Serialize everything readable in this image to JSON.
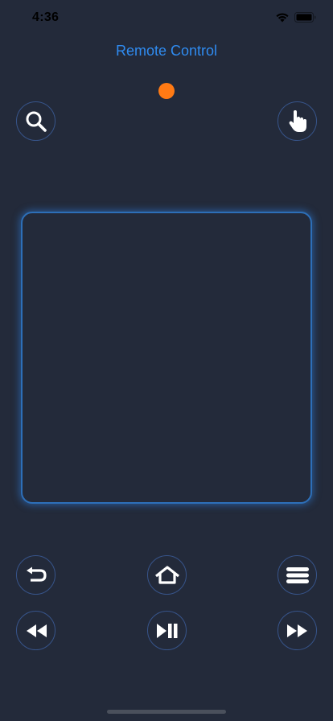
{
  "status_bar": {
    "time": "4:36"
  },
  "header": {
    "title": "Remote Control",
    "title_color": "#2f8bf0",
    "connection_indicator_color": "#ff7a14"
  },
  "top_controls": {
    "left_icon": "search-icon",
    "right_icon": "hand-pointer-icon"
  },
  "touchpad": {
    "border_color": "#2d6fb8"
  },
  "bottom_controls": {
    "row1": [
      "back-arrow-icon",
      "home-icon",
      "menu-icon"
    ],
    "row2": [
      "rewind-icon",
      "play-pause-icon",
      "fast-forward-icon"
    ]
  },
  "colors": {
    "background": "#232a3a",
    "button_border": "#37548a"
  }
}
